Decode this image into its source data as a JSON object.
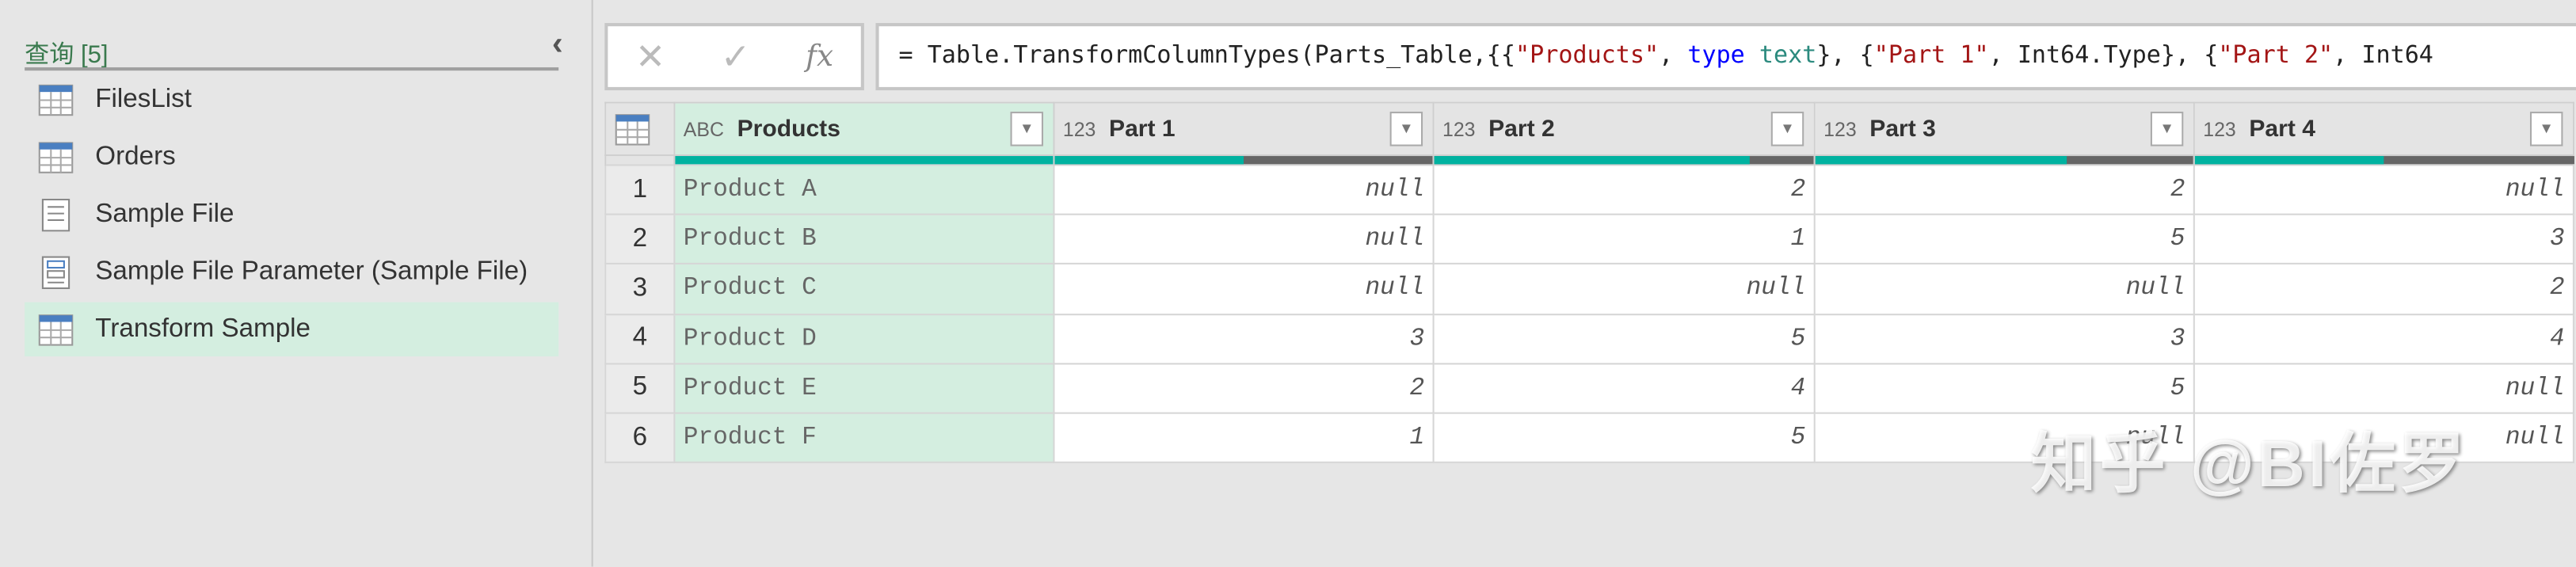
{
  "queries": {
    "title": "查询 [5]",
    "items": [
      {
        "label": "FilesList",
        "icon": "table"
      },
      {
        "label": "Orders",
        "icon": "table"
      },
      {
        "label": "Sample File",
        "icon": "document"
      },
      {
        "label": "Sample File Parameter (Sample File)",
        "icon": "parameter"
      },
      {
        "label": "Transform Sample",
        "icon": "table",
        "selected": true
      }
    ]
  },
  "formula": {
    "cancel": "✕",
    "commit": "✓",
    "fx": "fx",
    "parts": [
      "= Table.TransformColumnTypes(Parts_Table,{{",
      "\"Products\"",
      ", ",
      "type",
      " text",
      "}, {",
      "\"Part 1\"",
      ", Int64.Type}, {",
      "\"Part 2\"",
      ", Int64"
    ]
  },
  "table": {
    "columns": [
      {
        "name": "Products",
        "type": "ABC",
        "valid": 1.0
      },
      {
        "name": "Part 1",
        "type": "123",
        "valid": 0.5
      },
      {
        "name": "Part 2",
        "type": "123",
        "valid": 0.833
      },
      {
        "name": "Part 3",
        "type": "123",
        "valid": 0.667
      },
      {
        "name": "Part 4",
        "type": "123",
        "valid": 0.5
      }
    ],
    "rows": [
      [
        "1",
        "Product A",
        "null",
        "2",
        "2",
        "null"
      ],
      [
        "2",
        "Product B",
        "null",
        "1",
        "5",
        "3"
      ],
      [
        "3",
        "Product C",
        "null",
        "null",
        "null",
        "2"
      ],
      [
        "4",
        "Product D",
        "3",
        "5",
        "3",
        "4"
      ],
      [
        "5",
        "Product E",
        "2",
        "4",
        "5",
        "null"
      ],
      [
        "6",
        "Product F",
        "1",
        "5",
        "null",
        "null"
      ]
    ]
  },
  "watermark": "知乎 @BI佐罗",
  "colors": {
    "accent": "#00b2a0",
    "selected": "#d4eee0"
  }
}
